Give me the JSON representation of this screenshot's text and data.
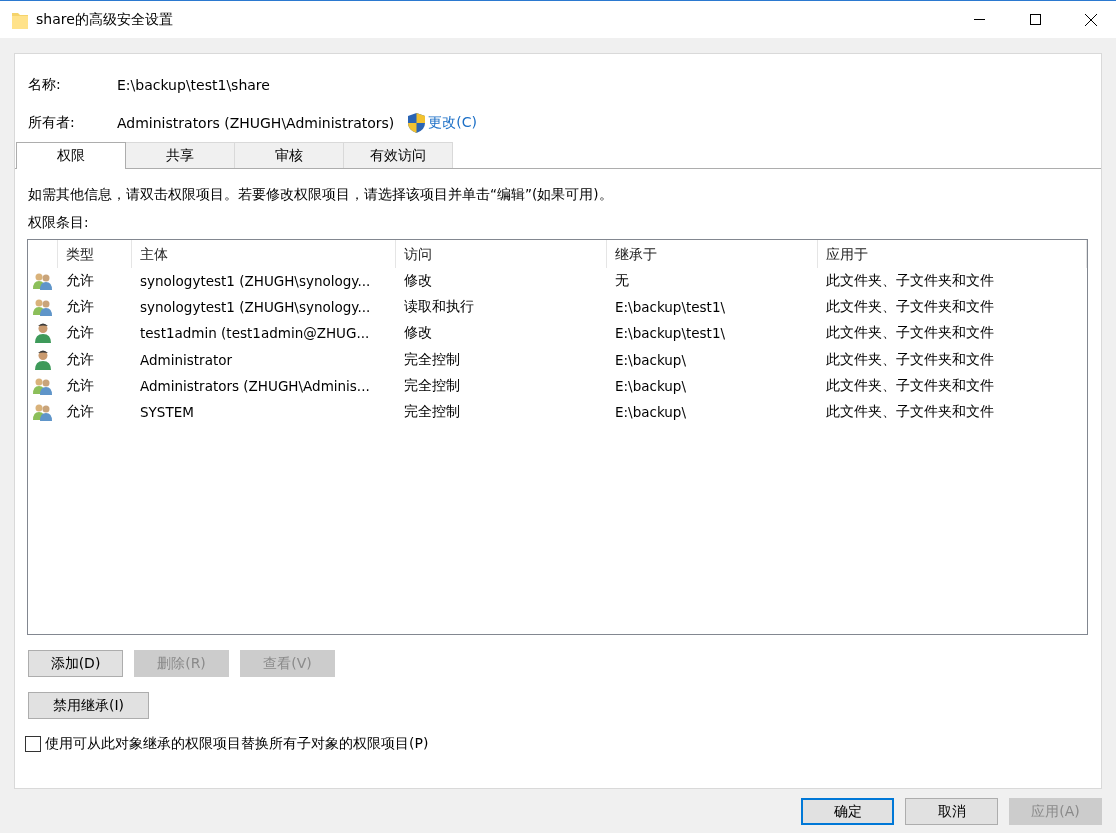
{
  "window": {
    "title": "share的高级安全设置"
  },
  "name_field": {
    "label": "名称:",
    "value": "E:\\backup\\test1\\share"
  },
  "owner_field": {
    "label": "所有者:",
    "value": "Administrators (ZHUGH\\Administrators)",
    "link": "更改(C)"
  },
  "tabs": [
    {
      "label": "权限",
      "selected": true
    },
    {
      "label": "共享",
      "selected": false
    },
    {
      "label": "审核",
      "selected": false
    },
    {
      "label": "有效访问",
      "selected": false
    }
  ],
  "info_text": "如需其他信息，请双击权限项目。若要修改权限项目，请选择该项目并单击“编辑”(如果可用)。",
  "list_label": "权限条目:",
  "table": {
    "columns": [
      "类型",
      "主体",
      "访问",
      "继承于",
      "应用于"
    ],
    "rows": [
      {
        "kind": "group",
        "type": "允许",
        "principal": "synologytest1 (ZHUGH\\synology...",
        "access": "修改",
        "inherited_from": "无",
        "applies_to": "此文件夹、子文件夹和文件"
      },
      {
        "kind": "group",
        "type": "允许",
        "principal": "synologytest1 (ZHUGH\\synology...",
        "access": "读取和执行",
        "inherited_from": "E:\\backup\\test1\\",
        "applies_to": "此文件夹、子文件夹和文件"
      },
      {
        "kind": "user",
        "type": "允许",
        "principal": "test1admin (test1admin@ZHUG...",
        "access": "修改",
        "inherited_from": "E:\\backup\\test1\\",
        "applies_to": "此文件夹、子文件夹和文件"
      },
      {
        "kind": "user",
        "type": "允许",
        "principal": "Administrator",
        "access": "完全控制",
        "inherited_from": "E:\\backup\\",
        "applies_to": "此文件夹、子文件夹和文件"
      },
      {
        "kind": "group",
        "type": "允许",
        "principal": "Administrators (ZHUGH\\Adminis...",
        "access": "完全控制",
        "inherited_from": "E:\\backup\\",
        "applies_to": "此文件夹、子文件夹和文件"
      },
      {
        "kind": "group",
        "type": "允许",
        "principal": "SYSTEM",
        "access": "完全控制",
        "inherited_from": "E:\\backup\\",
        "applies_to": "此文件夹、子文件夹和文件"
      }
    ]
  },
  "entry_buttons": [
    {
      "label": "添加(D)",
      "disabled": false
    },
    {
      "label": "删除(R)",
      "disabled": true
    },
    {
      "label": "查看(V)",
      "disabled": true
    }
  ],
  "inheritance_button": {
    "label": "禁用继承(I)",
    "disabled": false
  },
  "replace_checkbox": {
    "label": "使用可从此对象继承的权限项目替换所有子对象的权限项目(P)",
    "checked": false
  },
  "dialog_buttons": [
    {
      "label": "确定",
      "disabled": false,
      "default": true
    },
    {
      "label": "取消",
      "disabled": false,
      "default": false
    },
    {
      "label": "应用(A)",
      "disabled": true,
      "default": false
    }
  ]
}
